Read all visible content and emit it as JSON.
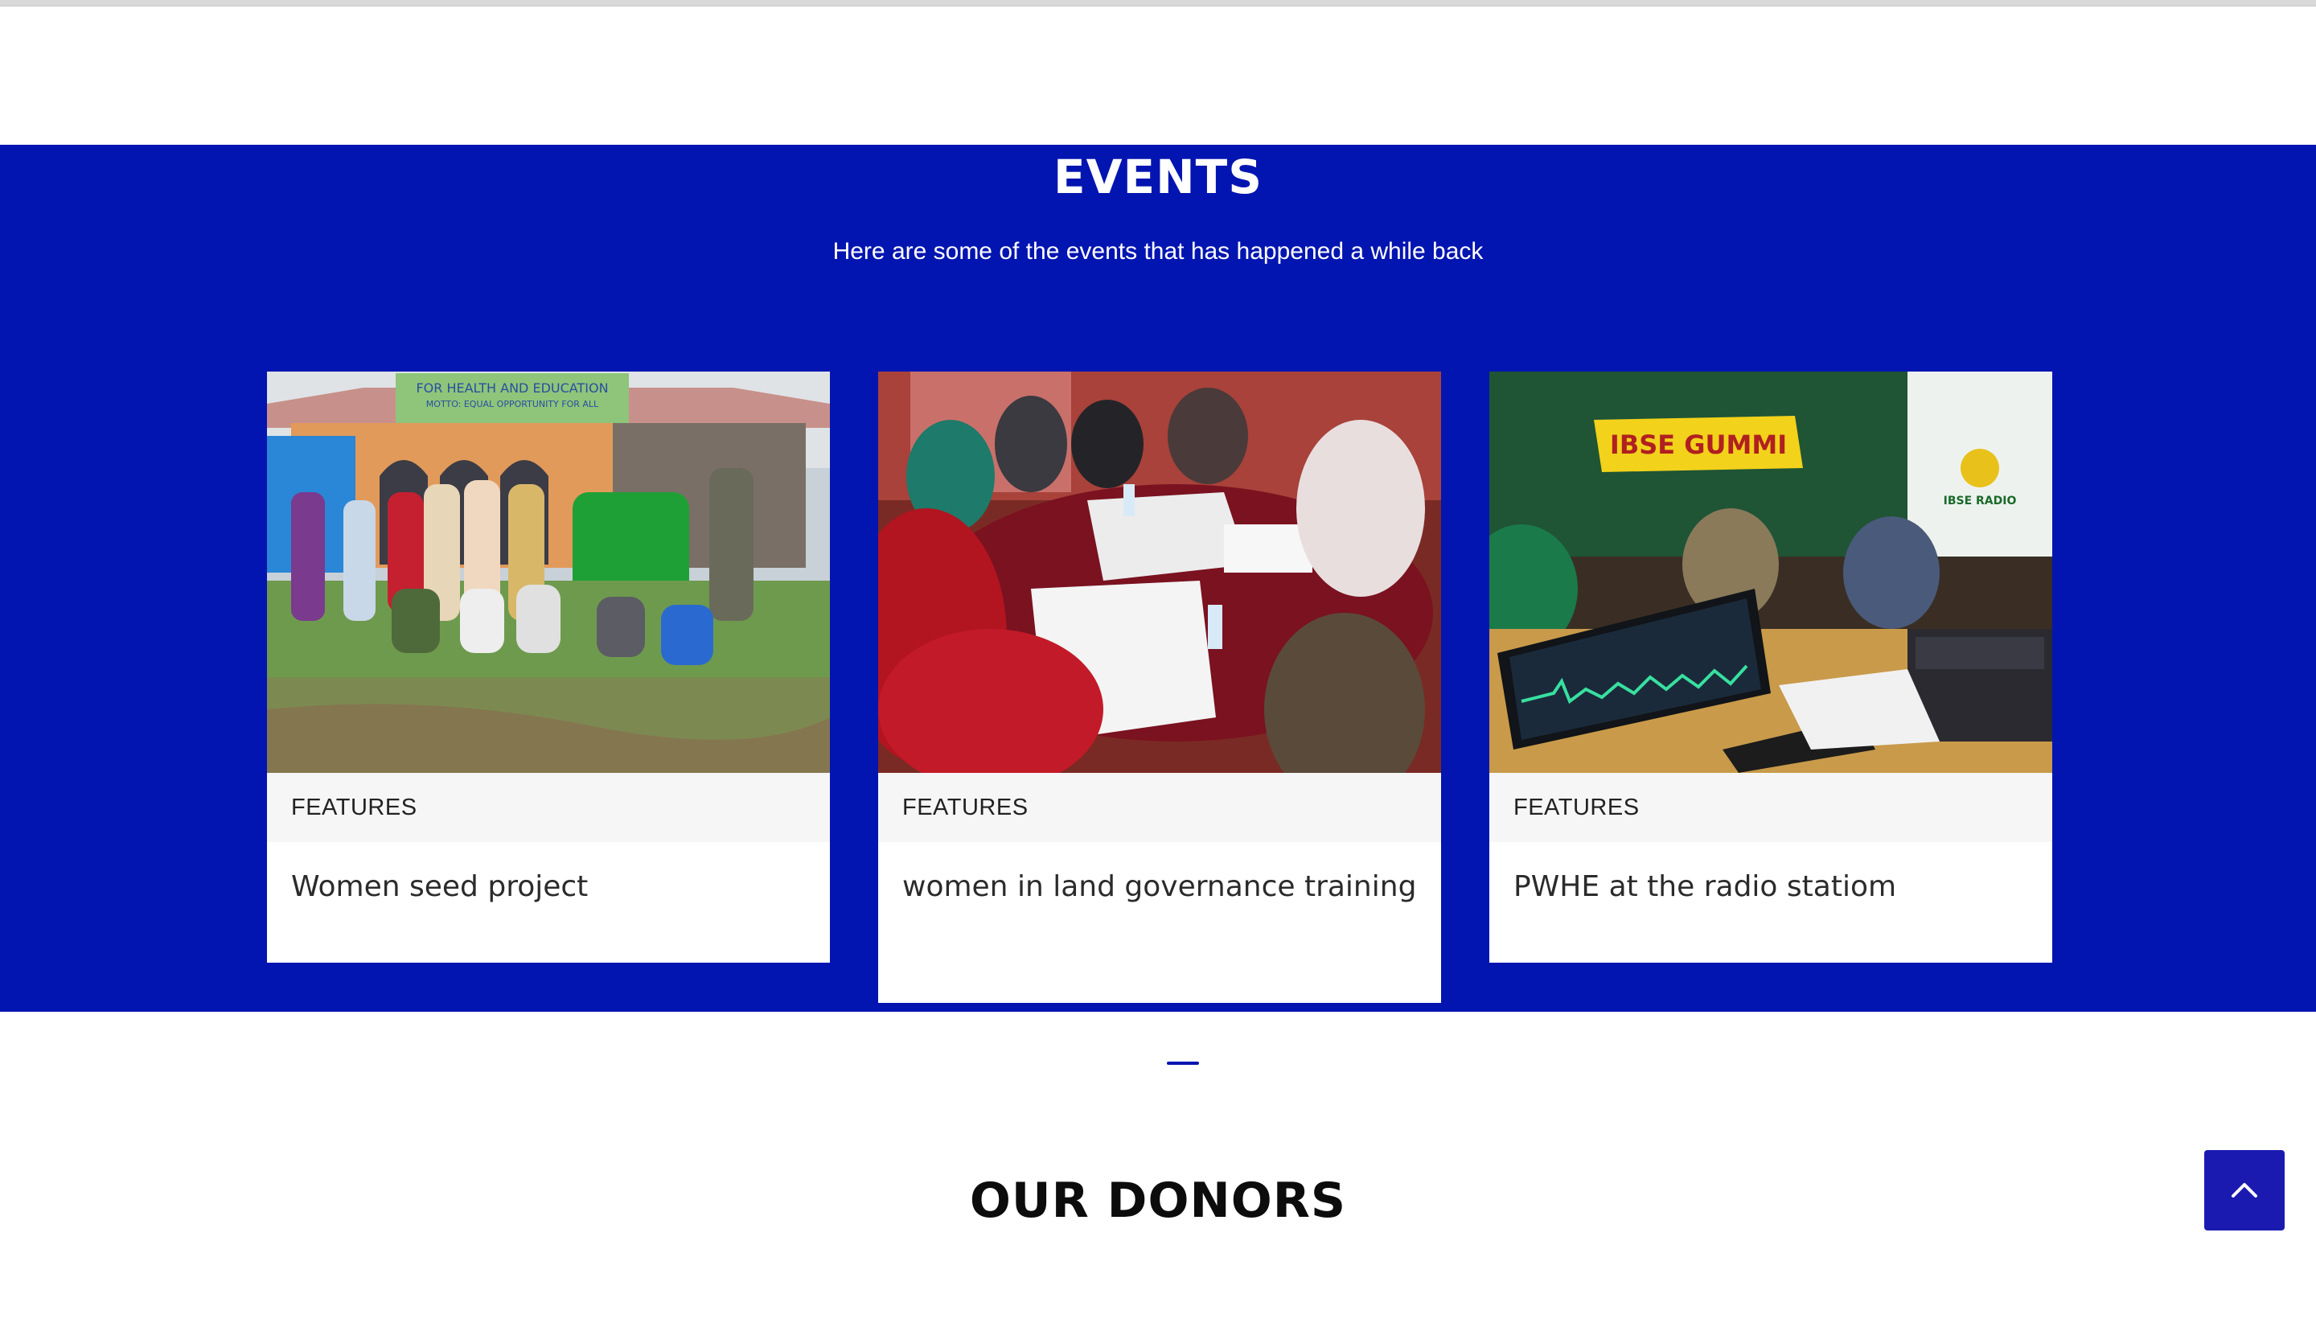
{
  "events": {
    "title": "EVENTS",
    "subtitle": "Here are some of the events that has happened a while back",
    "accent_color": "#0315b0",
    "cards": [
      {
        "category": "FEATURES",
        "title": "Women seed project",
        "image_sign_top": "FOR HEALTH AND EDUCATION",
        "image_sign_motto": "MOTTO: EQUAL OPPORTUNITY FOR ALL"
      },
      {
        "category": "FEATURES",
        "title": "women in land governance training"
      },
      {
        "category": "FEATURES",
        "title": "PWHE at the radio statiom",
        "image_banner_text": "IBSE GUMMI",
        "image_logo_text": "IBSE RADIO"
      }
    ]
  },
  "donors": {
    "title": "OUR DONORS"
  },
  "scroll_top": {
    "icon": "chevron-up-icon"
  }
}
